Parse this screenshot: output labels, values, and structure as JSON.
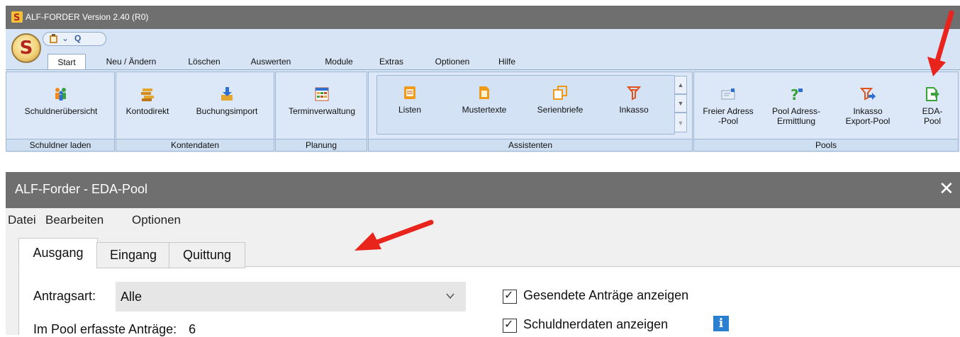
{
  "app": {
    "title": "ALF-FORDER Version 2.40 (R0)",
    "orb_letter": "S",
    "qat": {
      "icon_clipboard": "clipboard-icon",
      "chevron": "⌄",
      "search": "Q"
    },
    "tabs": [
      "Start",
      "Neu / Ändern",
      "Löschen",
      "Auswerten",
      "Module",
      "Extras",
      "Optionen",
      "Hilfe"
    ],
    "active_tab": "Start",
    "groups": {
      "schuldner": {
        "caption": "Schuldner laden",
        "buttons": [
          "Schuldnerübersicht"
        ]
      },
      "konten": {
        "caption": "Kontendaten",
        "buttons": [
          "Kontodirekt",
          "Buchungsimport"
        ]
      },
      "planung": {
        "caption": "Planung",
        "buttons": [
          "Terminverwaltung"
        ]
      },
      "assistenten": {
        "caption": "Assistenten",
        "buttons": [
          "Listen",
          "Mustertexte",
          "Serienbriefe",
          "Inkasso"
        ]
      },
      "pools": {
        "caption": "Pools",
        "buttons": [
          {
            "line1": "Freier Adress",
            "line2": "-Pool"
          },
          {
            "line1": "Pool Adress-",
            "line2": "Ermittlung"
          },
          {
            "line1": "Inkasso",
            "line2": "Export-Pool"
          },
          {
            "line1": "EDA-",
            "line2": "Pool"
          }
        ]
      }
    }
  },
  "dialog": {
    "title": "ALF-Forder - EDA-Pool",
    "close": "✕",
    "menu": [
      "Datei",
      "Bearbeiten",
      "Optionen"
    ],
    "tabs": [
      "Ausgang",
      "Eingang",
      "Quittung"
    ],
    "active_tab": "Ausgang",
    "antragsart": {
      "label": "Antragsart:",
      "value": "Alle"
    },
    "pool_count": {
      "label": "Im Pool erfasste Anträge:",
      "value": "6"
    },
    "checkboxes": [
      {
        "label": "Gesendete Anträge anzeigen",
        "checked": true
      },
      {
        "label": "Schuldnerdaten anzeigen",
        "checked": true
      }
    ],
    "info_icon": "i"
  },
  "colors": {
    "annotation_arrow": "#e8241c",
    "titlebar": "#6f6f6f",
    "ribbon": "#dce8f7"
  }
}
